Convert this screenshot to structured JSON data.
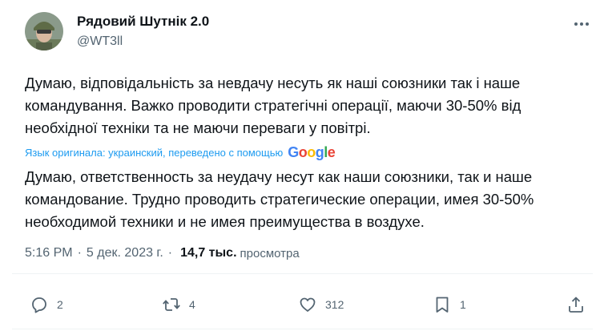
{
  "author": {
    "name": "Рядовий Шутнік 2.0",
    "handle": "@WT3ll"
  },
  "tweet": {
    "text": "Думаю, відповідальність за невдачу несуть як наші союзники так і наше командування. Важко проводити стратегічні операції, маючи 30-50% від необхідної техніки та не маючи переваги у повітрі.",
    "translation_label": "Язык оригинала: украинский, переведено с помощью",
    "translation_provider": {
      "letters": [
        "G",
        "o",
        "o",
        "g",
        "l",
        "e"
      ],
      "colors": [
        "#4285f4",
        "#ea4335",
        "#fbbc05",
        "#4285f4",
        "#34a853",
        "#ea4335"
      ]
    },
    "translated_text": "Думаю, ответственность за неудачу несут как наши союзники, так и наше командование. Трудно проводить стратегические операции, имея 30-50% необходимой техники и не имея преимущества в воздухе."
  },
  "meta": {
    "time": "5:16 PM",
    "separator": "·",
    "date": "5 дек. 2023 г.",
    "views_count": "14,7 тыс.",
    "views_label": "просмотра"
  },
  "actions": {
    "replies": "2",
    "reposts": "4",
    "likes": "312",
    "bookmarks": "1"
  },
  "icons": {
    "more": "more-icon",
    "reply": "reply-icon",
    "repost": "repost-icon",
    "like": "heart-icon",
    "bookmark": "bookmark-icon",
    "share": "share-icon"
  }
}
